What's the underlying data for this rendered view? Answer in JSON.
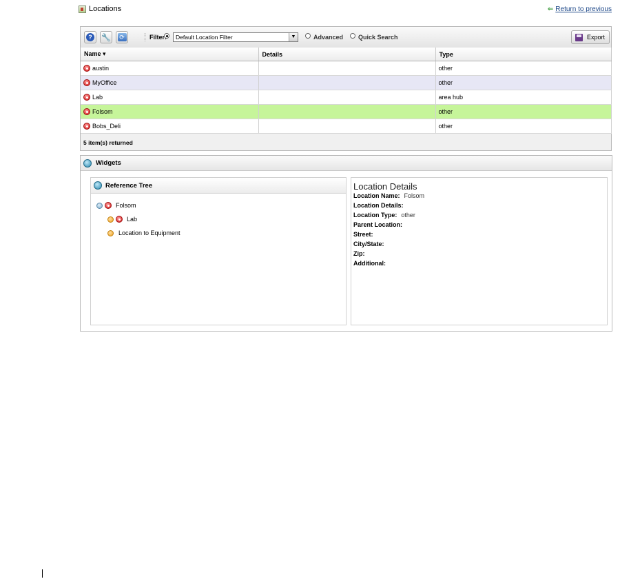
{
  "header": {
    "title": "Locations",
    "return_link": "Return to previous"
  },
  "toolbar": {
    "filter_label": "Filter:",
    "filter_value": "Default Location Filter",
    "advanced_label": "Advanced",
    "quick_search_label": "Quick Search",
    "export_label": "Export",
    "selected_mode": "Default Location Filter"
  },
  "grid": {
    "columns": [
      "Name ▾",
      "Details",
      "Type"
    ],
    "rows": [
      {
        "name": "austin",
        "details": "",
        "type": "other"
      },
      {
        "name": "MyOffice",
        "details": "",
        "type": "other"
      },
      {
        "name": "Lab",
        "details": "",
        "type": "area hub"
      },
      {
        "name": "Folsom",
        "details": "",
        "type": "other"
      },
      {
        "name": "Bobs_Deli",
        "details": "",
        "type": "other"
      }
    ],
    "selected_row": "Folsom",
    "footer": "5 item(s) returned"
  },
  "widgets": {
    "title": "Widgets",
    "tree": {
      "title": "Reference Tree",
      "nodes": [
        "Folsom",
        "Lab",
        "Location to Equipment"
      ]
    },
    "details": {
      "title": "Location Details",
      "fields": [
        {
          "label": "Location Name:",
          "value": "Folsom"
        },
        {
          "label": "Location Details:",
          "value": ""
        },
        {
          "label": "Location Type:",
          "value": "other"
        },
        {
          "label": "Parent Location:",
          "value": ""
        },
        {
          "label": "Street:",
          "value": ""
        },
        {
          "label": "City/State:",
          "value": ""
        },
        {
          "label": "Zip:",
          "value": ""
        },
        {
          "label": "Additional:",
          "value": ""
        }
      ]
    }
  },
  "colors": {
    "selected_row": "#c6f59a",
    "alt_row": "#e7e7f5",
    "link": "#204a8a"
  }
}
